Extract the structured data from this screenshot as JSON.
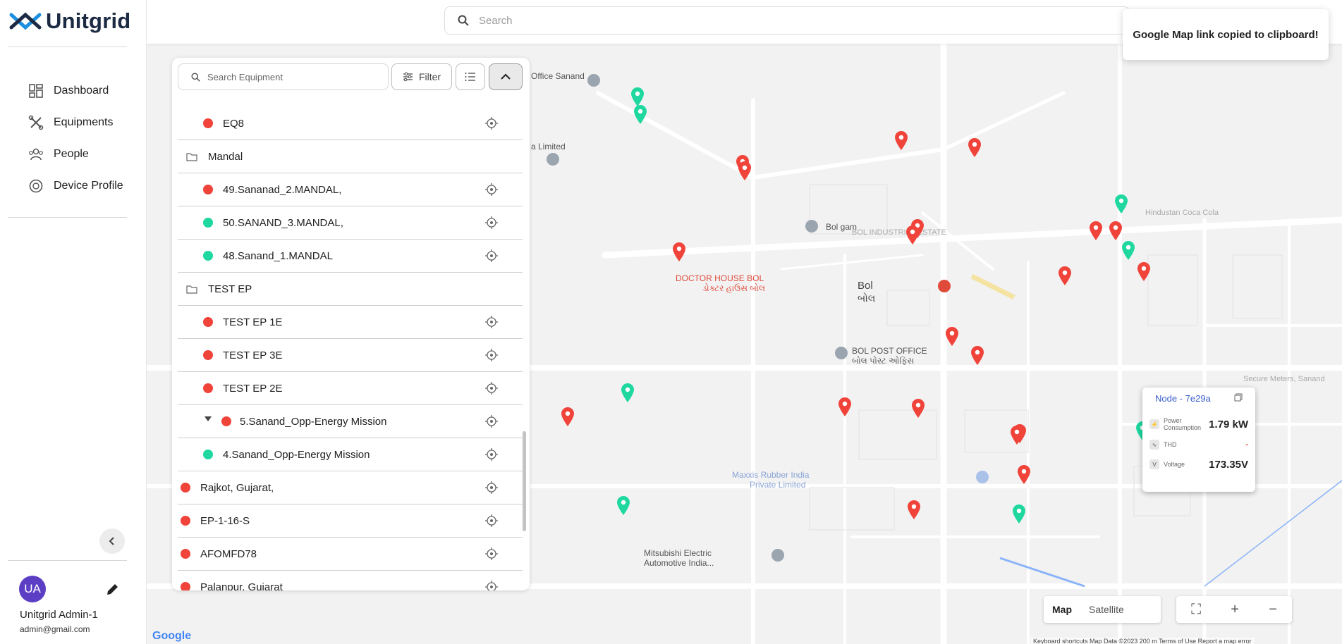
{
  "app": {
    "name": "Unitgrid"
  },
  "sidebar": {
    "items": [
      {
        "label": "Dashboard",
        "icon": "dashboard-icon"
      },
      {
        "label": "Equipments",
        "icon": "equipment-icon"
      },
      {
        "label": "People",
        "icon": "people-icon"
      },
      {
        "label": "Device Profile",
        "icon": "device-profile-icon"
      }
    ],
    "user": {
      "initials": "UA",
      "name": "Unitgrid Admin-1",
      "email": "admin@gmail.com"
    }
  },
  "topbar": {
    "search_placeholder": "Search"
  },
  "toast": {
    "message": "Google Map link copied to clipboard!"
  },
  "panel": {
    "search_placeholder": "Search Equipment",
    "filter_label": "Filter",
    "rows": [
      {
        "label": "EQ8",
        "kind": "item",
        "status": "red"
      },
      {
        "label": "Mandal",
        "kind": "folder"
      },
      {
        "label": "49.Sananad_2.MANDAL,",
        "kind": "item",
        "status": "red"
      },
      {
        "label": "50.SANAND_3.MANDAL,",
        "kind": "item",
        "status": "green"
      },
      {
        "label": "48.Sanand_1.MANDAL",
        "kind": "item",
        "status": "green"
      },
      {
        "label": "TEST EP",
        "kind": "folder"
      },
      {
        "label": "TEST EP 1E",
        "kind": "item",
        "status": "red"
      },
      {
        "label": "TEST EP 3E",
        "kind": "item",
        "status": "red"
      },
      {
        "label": "TEST EP 2E",
        "kind": "item",
        "status": "red"
      },
      {
        "label": "5.Sanand_Opp-Energy Mission",
        "kind": "expand",
        "status": "red"
      },
      {
        "label": "4.Sanand_Opp-Energy Mission",
        "kind": "item",
        "status": "green"
      },
      {
        "label": "Rajkot, Gujarat,",
        "kind": "top",
        "status": "red"
      },
      {
        "label": "EP-1-16-S",
        "kind": "top",
        "status": "red"
      },
      {
        "label": "AFOMFD78",
        "kind": "top",
        "status": "red"
      },
      {
        "label": "Palanpur, Gujarat",
        "kind": "top",
        "status": "red"
      }
    ]
  },
  "node_card": {
    "title": "Node - 7e29a",
    "metrics": [
      {
        "label": "Power Consumption",
        "value": "1.79 kW"
      },
      {
        "label": "THD",
        "value": "-"
      },
      {
        "label": "Voltage",
        "value": "173.35V"
      }
    ]
  },
  "map": {
    "labels": [
      {
        "text": "DOCTOR HOUSE BOL",
        "color": "#e04a3b"
      },
      {
        "text": "ડોક્ટર હાઉસ બોલ",
        "color": "#e04a3b"
      },
      {
        "text": "Bol gam",
        "color": "#555"
      },
      {
        "text": "Bol",
        "color": "#444"
      },
      {
        "text": "બોલ",
        "color": "#444"
      },
      {
        "text": "BOL POST OFFICE",
        "color": "#555"
      },
      {
        "text": "બોલ પોસ્ટ ઓફિસ",
        "color": "#555"
      },
      {
        "text": "Mitsubishi Electric",
        "color": "#555"
      },
      {
        "text": "Automotive India...",
        "color": "#555"
      },
      {
        "text": "a Limited",
        "color": "#555"
      },
      {
        "text": "Office Sanand",
        "color": "#555"
      },
      {
        "text": "Maxxis Rubber India",
        "color": "#8aa4d6"
      },
      {
        "text": "Private Limited",
        "color": "#8aa4d6"
      },
      {
        "text": "BOL INDUSTRIAL ESTATE",
        "color": "#aaa"
      },
      {
        "text": "Hindustan Coca Cola",
        "color": "#aaa"
      },
      {
        "text": "Secure Meters, Sanand",
        "color": "#aaa"
      }
    ],
    "type_options": [
      "Map",
      "Satellite"
    ],
    "zoom_in": "+",
    "zoom_out": "−",
    "google_text": "Google",
    "attribution": "Keyboard shortcuts   Map Data ©2023   200 m   Terms of Use   Report a map error",
    "status_colors": {
      "red": "#f0433a",
      "green": "#1ed8a0"
    }
  }
}
